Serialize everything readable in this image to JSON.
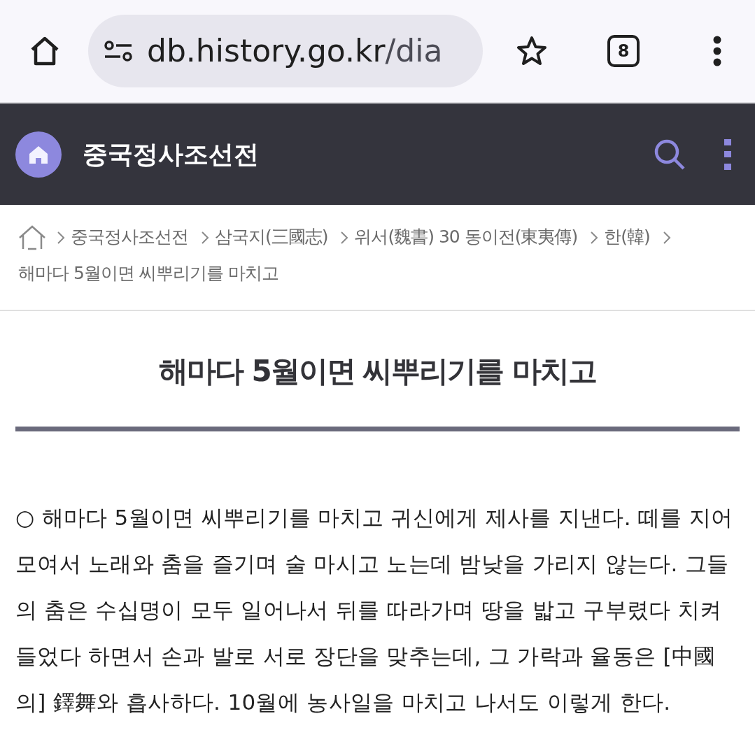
{
  "browser": {
    "url_host": "db.history.go.kr",
    "url_path": "/dia",
    "tab_count": "8"
  },
  "header": {
    "title": "중국정사조선전"
  },
  "breadcrumb": [
    {
      "label": "중국정사조선전"
    },
    {
      "label": "삼국지(三國志)"
    },
    {
      "label": "위서(魏書) 30 동이전(東夷傳)"
    },
    {
      "label": "한(韓)"
    },
    {
      "label": "해마다 5월이면 씨뿌리기를 마치고"
    }
  ],
  "article": {
    "title": "해마다 5월이면 씨뿌리기를 마치고",
    "body": "○ 해마다 5월이면 씨뿌리기를 마치고 귀신에게 제사를 지낸다. 떼를 지어 모여서 노래와 춤을 즐기며 술 마시고 노는데 밤낮을 가리지 않는다. 그들의 춤은 수십명이 모두 일어나서 뒤를 따라가며 땅을 밟고 구부렸다 치켜들었다 하면서 손과 발로 서로 장단을 맞추는데, 그 가락과 율동은 [中國의] 鐸舞와 흡사하다. 10월에 농사일을 마치고 나서도 이렇게 한다."
  }
}
